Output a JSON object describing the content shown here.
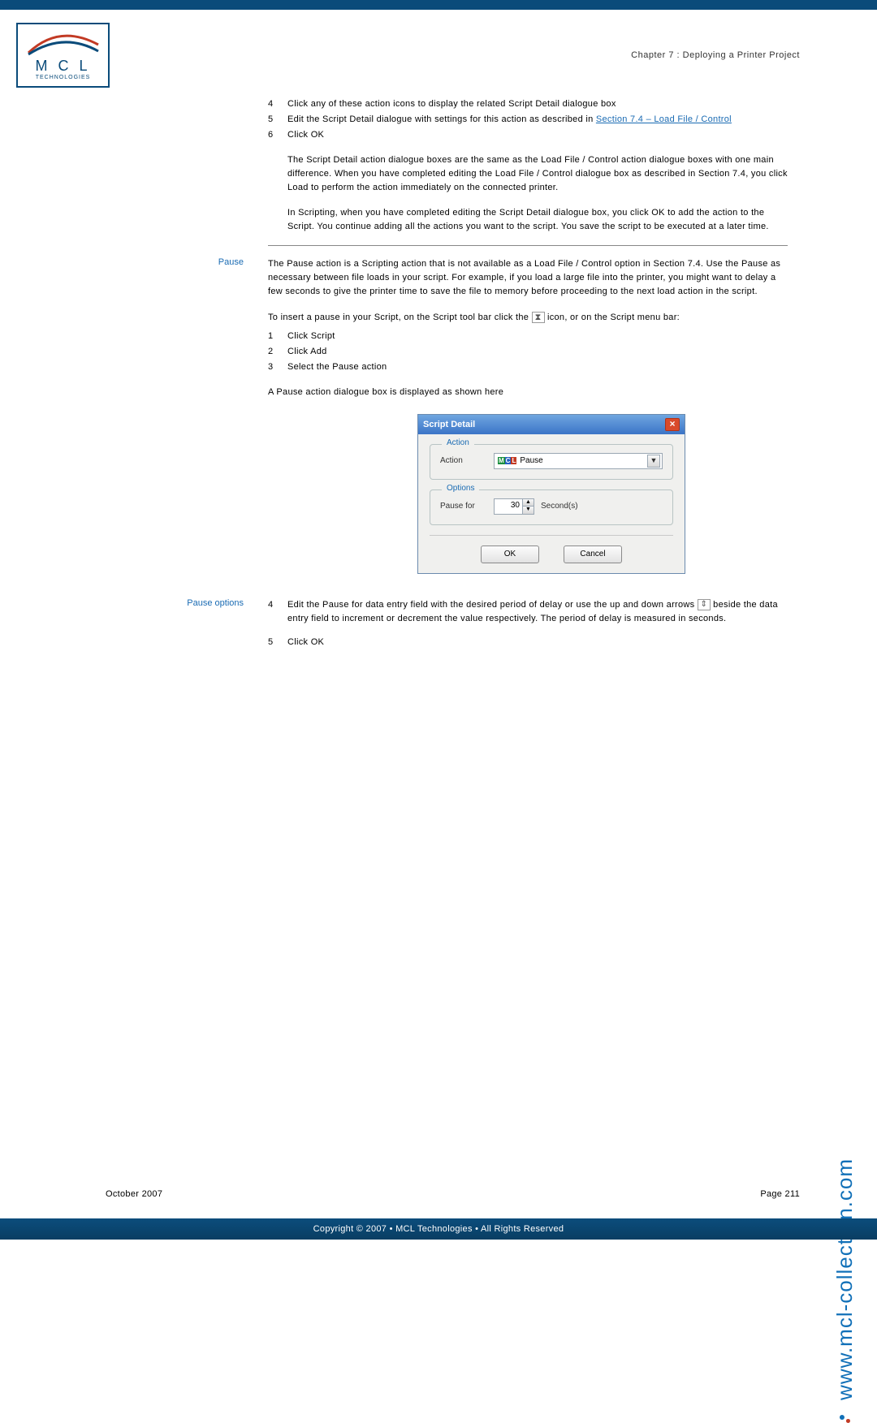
{
  "header": {
    "chapter": "Chapter 7 : Deploying a Printer Project"
  },
  "logo": {
    "main": "M C L",
    "sub": "TECHNOLOGIES"
  },
  "steps_top": {
    "s4": "Click any of these action icons to display the related Script Detail dialogue box",
    "s5_prefix": "Edit the Script Detail dialogue with settings for this action as described in ",
    "s5_link": "Section 7.4 – Load File / Control",
    "s6": "Click OK"
  },
  "para1": "The Script Detail action dialogue boxes are the same as the Load File / Control action dialogue boxes with one main difference. When you have completed editing the Load File / Control dialogue box as described in Section 7.4, you click Load to perform the action immediately on the connected printer.",
  "para2": "In Scripting, when you have completed editing the Script Detail dialogue box, you click OK to add the action to the Script. You continue adding all the actions you want to the script. You save the script to be executed at a later time.",
  "pause": {
    "label": "Pause",
    "para": "The Pause action is a Scripting action that is not available as a Load File / Control option in Section 7.4. Use the Pause as necessary between file loads in your script. For example, if you load a large file into the printer, you might want to delay a few seconds to give the printer time to save the file to memory before proceeding to the next load action in the script.",
    "insert_prefix": "To insert a pause in your Script, on the Script tool bar click the ",
    "insert_suffix": " icon, or on the Script menu bar:",
    "s1": "Click Script",
    "s2": "Click Add",
    "s3": "Select the Pause action",
    "shown": "A Pause action dialogue box is displayed as shown here"
  },
  "dialog": {
    "title": "Script Detail",
    "action_legend": "Action",
    "action_label": "Action",
    "action_value": "Pause",
    "options_legend": "Options",
    "pause_for_label": "Pause for",
    "pause_for_value": "30",
    "pause_for_suffix": "Second(s)",
    "ok": "OK",
    "cancel": "Cancel"
  },
  "pause_options": {
    "label": "Pause options",
    "s4_prefix": "Edit the Pause for data entry field with the desired period of delay or use the up and down arrows ",
    "s4_suffix": " beside the data entry field to increment or decrement the value respectively. The period of delay is measured in seconds.",
    "s5": "Click OK"
  },
  "footer": {
    "date": "October 2007",
    "page": "Page 211",
    "copyright": "Copyright © 2007 • MCL Technologies • All Rights Reserved"
  },
  "side_url": "www.mcl-collection.com"
}
